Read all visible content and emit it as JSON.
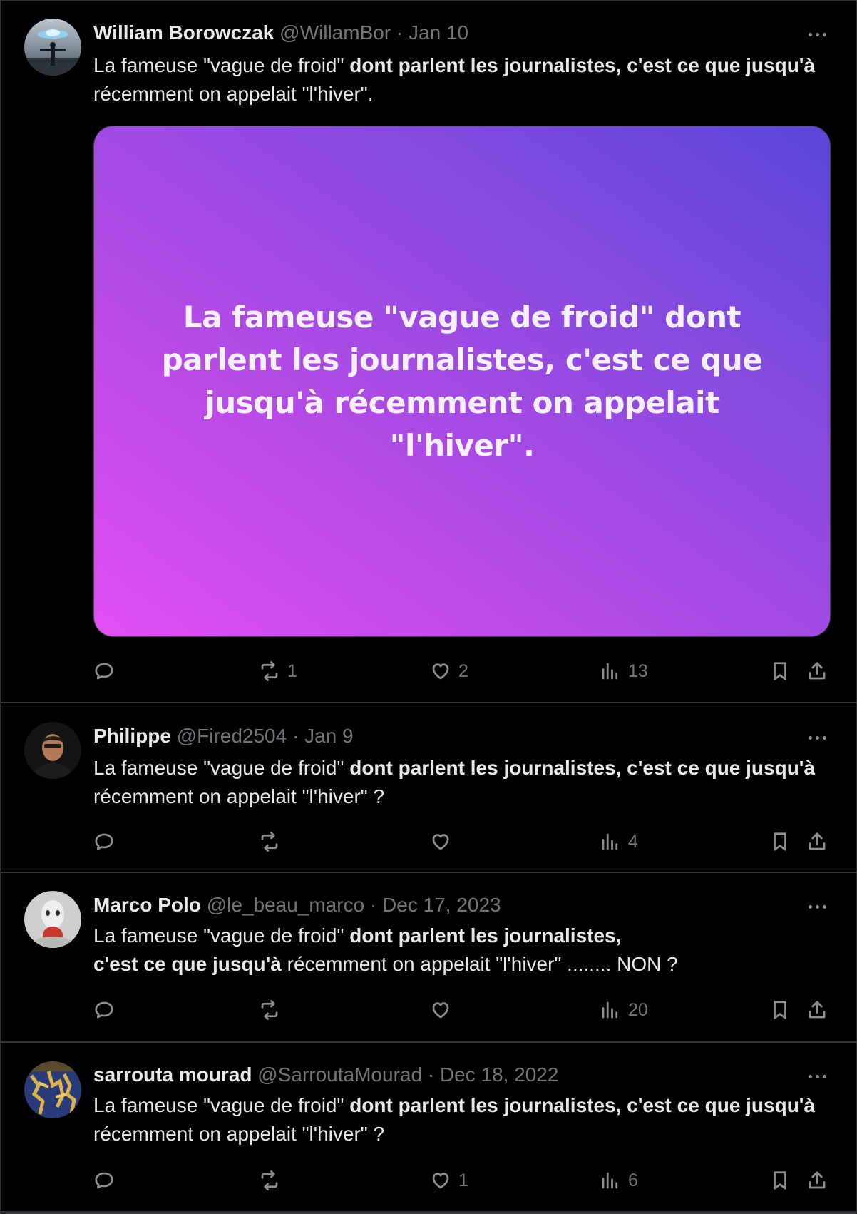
{
  "tweets": [
    {
      "name": "William Borowczak",
      "handle": "@WillamBor",
      "date": "Jan 10",
      "text_plain_1": "La fameuse \"vague de froid\" ",
      "text_bold_1": "dont parlent les journalistes, c'est ce que jusqu'à",
      "text_plain_2": " récemment on appelait \"l'hiver\".",
      "media_text": "La fameuse \"vague de froid\" dont parlent les journalistes, c'est ce que jusqu'à récemment on appelait \"l'hiver\".",
      "replies": "",
      "retweets": "1",
      "likes": "2",
      "views": "13"
    },
    {
      "name": "Philippe",
      "handle": "@Fired2504",
      "date": "Jan 9",
      "text_plain_1": "La fameuse \"vague de froid\" ",
      "text_bold_1": "dont parlent les journalistes, c'est ce que jusqu'à",
      "text_plain_2": " récemment on appelait \"l'hiver\" ?",
      "replies": "",
      "retweets": "",
      "likes": "",
      "views": "4"
    },
    {
      "name": "Marco Polo",
      "handle": "@le_beau_marco",
      "date": "Dec 17, 2023",
      "text_plain_1": "La fameuse \"vague de froid\" ",
      "text_bold_1": "dont parlent les journalistes,",
      "text_bold_2": "c'est ce que jusqu'à",
      "text_plain_2": " récemment on appelait \"l'hiver\" ........ NON ?",
      "replies": "",
      "retweets": "",
      "likes": "",
      "views": "20"
    },
    {
      "name": "sarrouta mourad",
      "handle": "@SarroutaMourad",
      "date": "Dec 18, 2022",
      "text_plain_1": "La fameuse \"vague de froid\" ",
      "text_bold_1": "dont parlent les journalistes, c'est ce que jusqu'à",
      "text_plain_2": " récemment on appelait \"l'hiver\" ?",
      "replies": "",
      "retweets": "",
      "likes": "1",
      "views": "6"
    }
  ],
  "separator": "·",
  "icons": [
    "more-icon",
    "reply-icon",
    "retweet-icon",
    "like-icon",
    "views-icon",
    "bookmark-icon",
    "share-icon"
  ],
  "colors": {
    "background": "#000000",
    "text": "#e7e9ea",
    "muted": "#71767b",
    "divider": "#2f3336"
  }
}
